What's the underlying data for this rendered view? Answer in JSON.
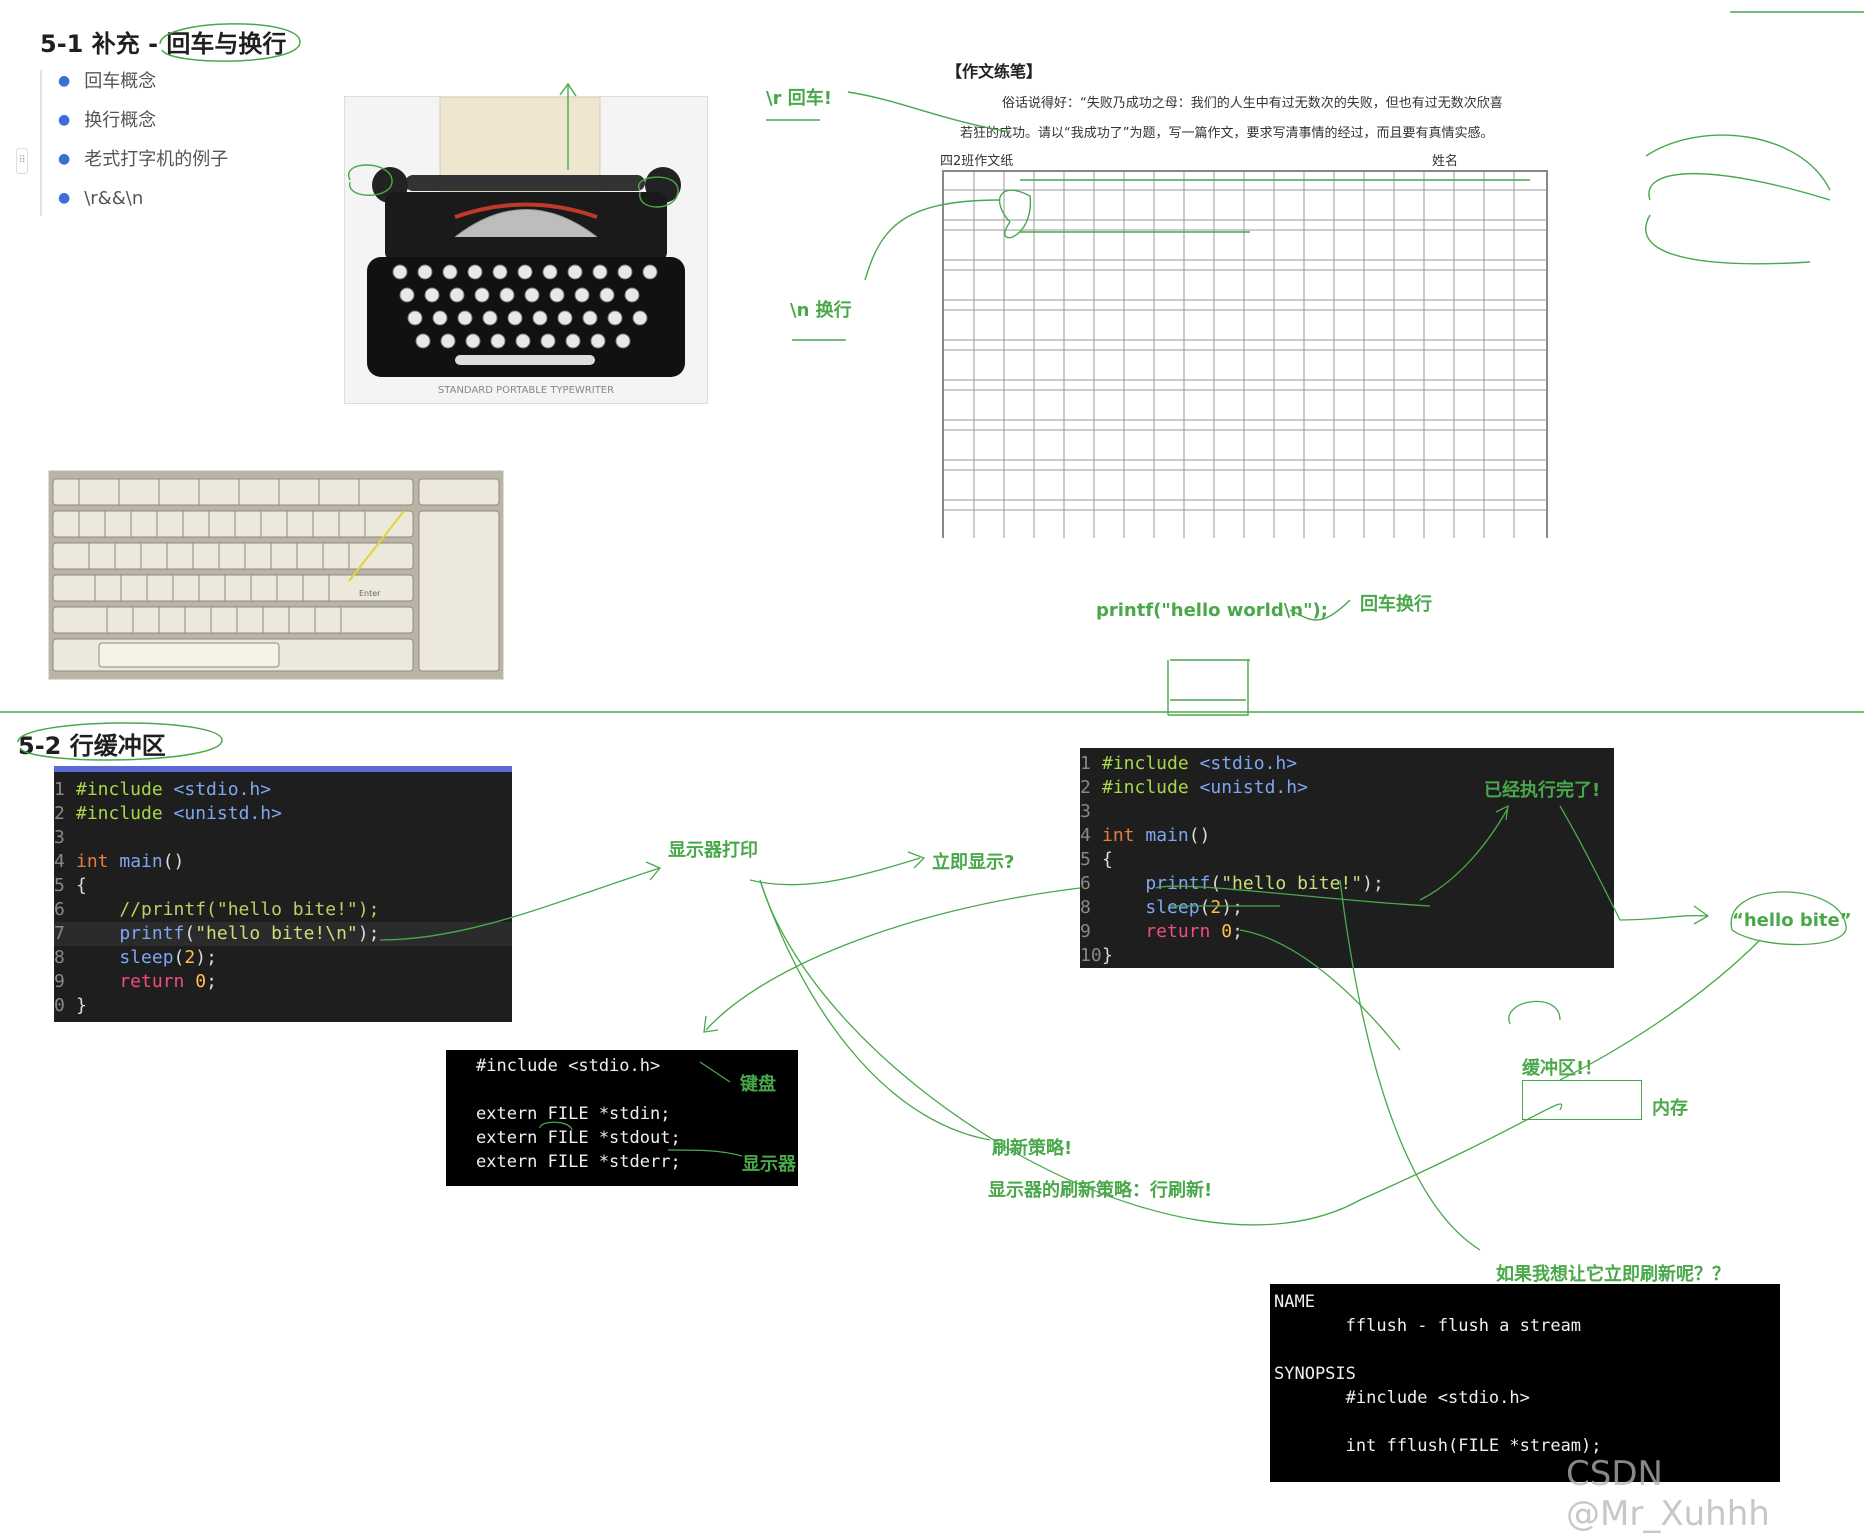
{
  "section1": {
    "title": "5-1 补充 - 回车与换行",
    "bullets": [
      "回车概念",
      "换行概念",
      "老式打字机的例子",
      "\\r&&\\n"
    ]
  },
  "typewriter": {
    "brand_text": "STANDARD PORTABLE TYPEWRITER"
  },
  "paper": {
    "header": "【作文练笔】",
    "line1": "俗话说得好：“失败乃成功之母：我们的人生中有过无数次的失败，但也有过无数次欣喜",
    "line2": "若狂的成功。请以“我成功了”为题，写一篇作文，要求写清事情的经过，而且要有真情实感。",
    "class_label": "四2班作文纸",
    "name_label": "姓名"
  },
  "annotations": {
    "cr": "\\r 回车!",
    "lf": "\\n  换行",
    "printf_hello_world": "printf(\"hello world\\n\");",
    "crlf": "回车换行",
    "display_print": "显示器打印",
    "show_immediately": "立即显示?",
    "already_done": "已经执行完了!",
    "hello_bite_bubble": "“hello bite”",
    "buffer": "缓冲区!！",
    "memory": "内存",
    "keyboard_label": "键盘",
    "display_label": "显示器",
    "flush_policy": "刷新策略!",
    "display_flush_policy": "显示器的刷新策略：行刷新!",
    "flush_now_question": "如果我想让它立即刷新呢？？"
  },
  "section2": {
    "title": "5-2 行缓冲区"
  },
  "code_left": {
    "lines": [
      {
        "n": "1",
        "parts": [
          [
            "inc",
            "#include "
          ],
          [
            "hdr",
            "<stdio.h>"
          ]
        ]
      },
      {
        "n": "2",
        "parts": [
          [
            "inc",
            "#include "
          ],
          [
            "hdr",
            "<unistd.h>"
          ]
        ]
      },
      {
        "n": "3",
        "parts": []
      },
      {
        "n": "4",
        "parts": [
          [
            "kw",
            "int "
          ],
          [
            "fn",
            "main"
          ],
          [
            "plain",
            "()"
          ]
        ]
      },
      {
        "n": "5",
        "parts": [
          [
            "plain",
            "{"
          ]
        ]
      },
      {
        "n": "6",
        "parts": [
          [
            "cmt",
            "    //printf(\"hello bite!\");"
          ]
        ]
      },
      {
        "n": "7",
        "parts": [
          [
            "fn",
            "    printf"
          ],
          [
            "plain",
            "("
          ],
          [
            "str",
            "\"hello bite!\\n\""
          ],
          [
            "plain",
            ");"
          ]
        ]
      },
      {
        "n": "8",
        "parts": [
          [
            "fn",
            "    sleep"
          ],
          [
            "plain",
            "("
          ],
          [
            "num2",
            "2"
          ],
          [
            "plain",
            ");"
          ]
        ]
      },
      {
        "n": "9",
        "parts": [
          [
            "ret",
            "    return "
          ],
          [
            "num2",
            "0"
          ],
          [
            "plain",
            ";"
          ]
        ]
      },
      {
        "n": "0",
        "parts": [
          [
            "plain",
            "}"
          ]
        ]
      }
    ]
  },
  "code_right": {
    "lines": [
      {
        "n": "1",
        "parts": [
          [
            "inc",
            "#include "
          ],
          [
            "hdr",
            "<stdio.h>"
          ]
        ]
      },
      {
        "n": "2",
        "parts": [
          [
            "inc",
            "#include "
          ],
          [
            "hdr",
            "<unistd.h>"
          ]
        ]
      },
      {
        "n": "3",
        "parts": []
      },
      {
        "n": "4",
        "parts": [
          [
            "kw",
            "int "
          ],
          [
            "fn",
            "main"
          ],
          [
            "plain",
            "()"
          ]
        ]
      },
      {
        "n": "5",
        "parts": [
          [
            "plain",
            "{"
          ]
        ]
      },
      {
        "n": "6",
        "parts": [
          [
            "fn",
            "    printf"
          ],
          [
            "plain",
            "("
          ],
          [
            "str",
            "\"hello bite!\""
          ],
          [
            "plain",
            ");"
          ]
        ]
      },
      {
        "n": "8",
        "parts": [
          [
            "fn",
            "    sleep"
          ],
          [
            "plain",
            "("
          ],
          [
            "num2",
            "2"
          ],
          [
            "plain",
            ");"
          ]
        ]
      },
      {
        "n": "9",
        "parts": [
          [
            "ret",
            "    return "
          ],
          [
            "num2",
            "0"
          ],
          [
            "plain",
            ";"
          ]
        ]
      },
      {
        "n": "10",
        "parts": [
          [
            "plain",
            "}"
          ]
        ]
      }
    ]
  },
  "stdio_snippet": {
    "lines": [
      "#include <stdio.h>",
      "",
      "extern FILE *stdin;",
      "extern FILE *stdout;",
      "extern FILE *stderr;"
    ]
  },
  "man_page": {
    "lines": [
      "NAME",
      "       fflush - flush a stream",
      "",
      "SYNOPSIS",
      "       #include <stdio.h>",
      "",
      "       int fflush(FILE *stream);"
    ]
  },
  "watermark": "CSDN @Mr_Xuhhh",
  "colors": {
    "annotation_green": "#49a84a",
    "bullet_blue": "#3b6fd6",
    "code_bg": "#1e1e1e"
  }
}
